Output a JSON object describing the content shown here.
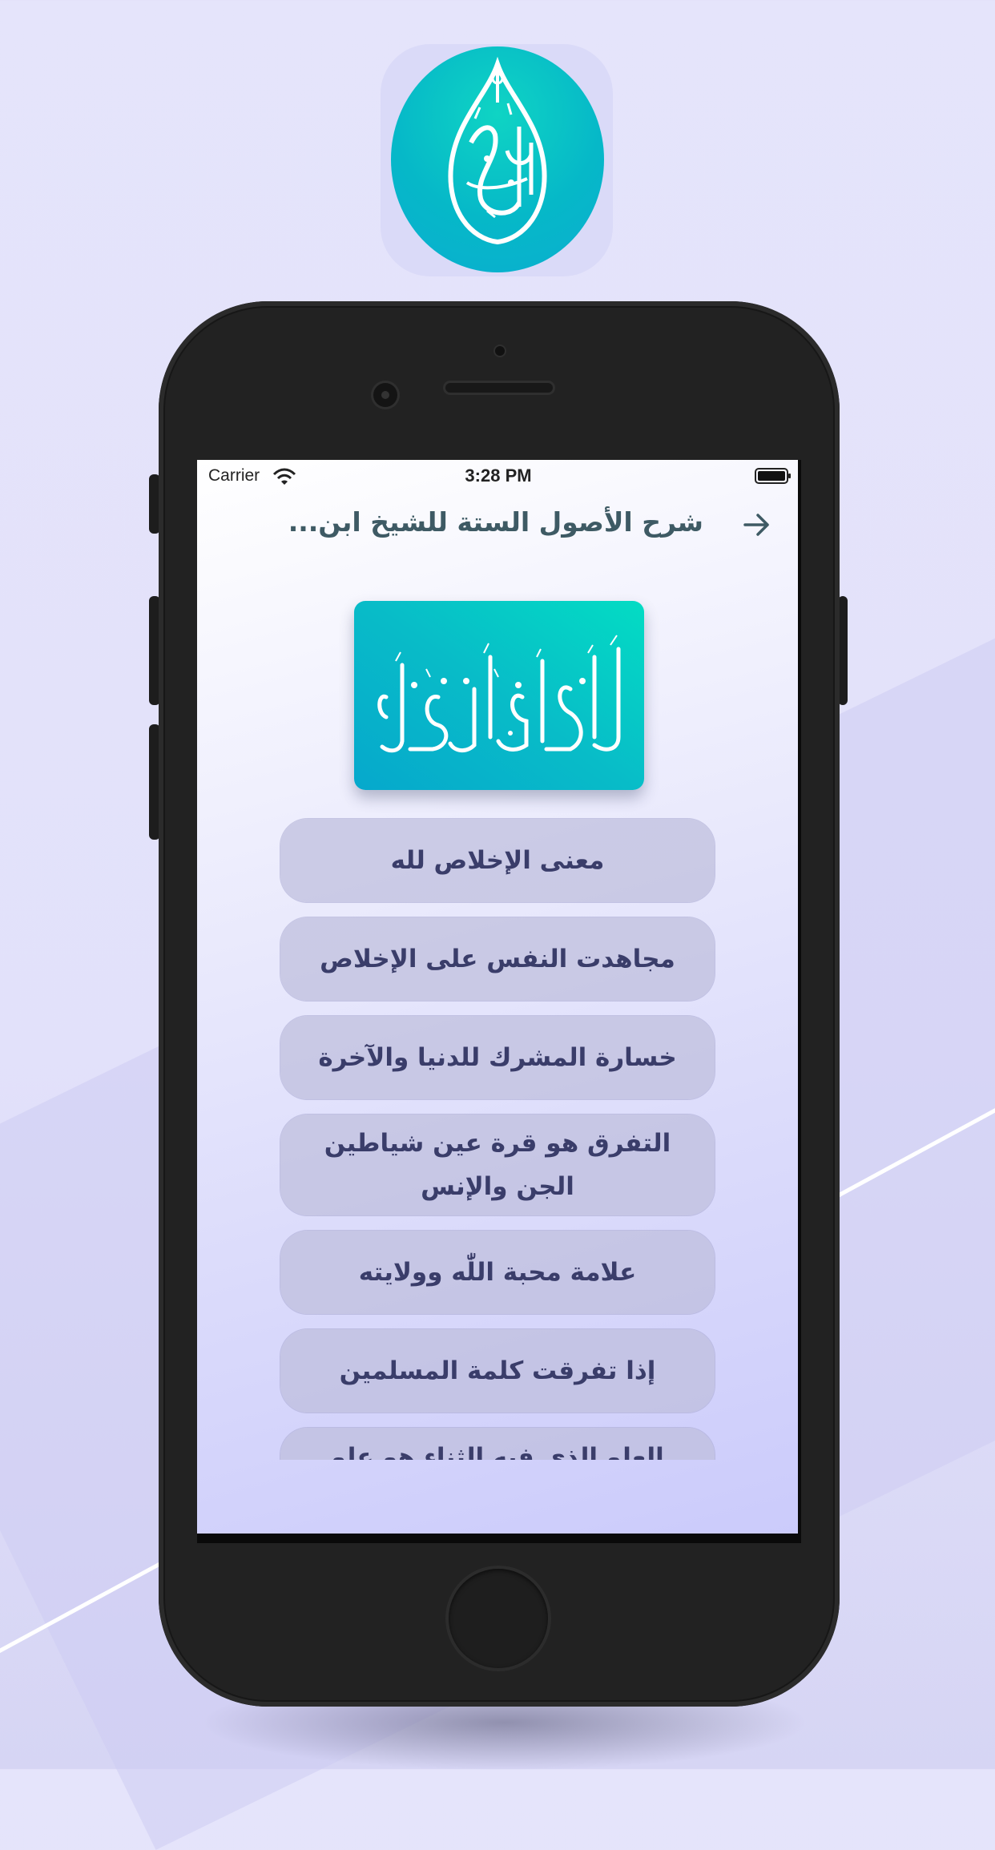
{
  "background": {
    "accent": "#e5e4fb",
    "line_color": "#ffffff"
  },
  "app_icon": {
    "name": "calligraphy-app-icon",
    "colors": [
      "#0fd4c4",
      "#0aaed0"
    ],
    "calligraphy_text": "أخي بنيّة"
  },
  "status_bar": {
    "carrier": "Carrier",
    "time": "3:28 PM",
    "wifi_icon": "wifi-icon",
    "battery_icon": "battery-icon"
  },
  "nav": {
    "title": "شرح الأصول الستة للشيخ ابن...",
    "back_icon": "arrow-right-icon",
    "title_color": "#3e5a64"
  },
  "banner": {
    "calligraphy_text": "الفوائد المنتقاة",
    "colors": [
      "#06a8cc",
      "#03dcc4"
    ]
  },
  "topics": [
    {
      "label": "معنى الإخلاص لله"
    },
    {
      "label": "مجاهدت النفس على الإخلاص"
    },
    {
      "label": "خسارة المشرك للدنيا والآخرة"
    },
    {
      "label": "التفرق هو قرة عين شياطين الجن والإنس"
    },
    {
      "label": "علامة محبة اللّٰه وولايته"
    },
    {
      "label": "إذا تفرقت كلمة المسلمين"
    },
    {
      "label": "العلو الذي فيه الثناء هو علو"
    }
  ]
}
